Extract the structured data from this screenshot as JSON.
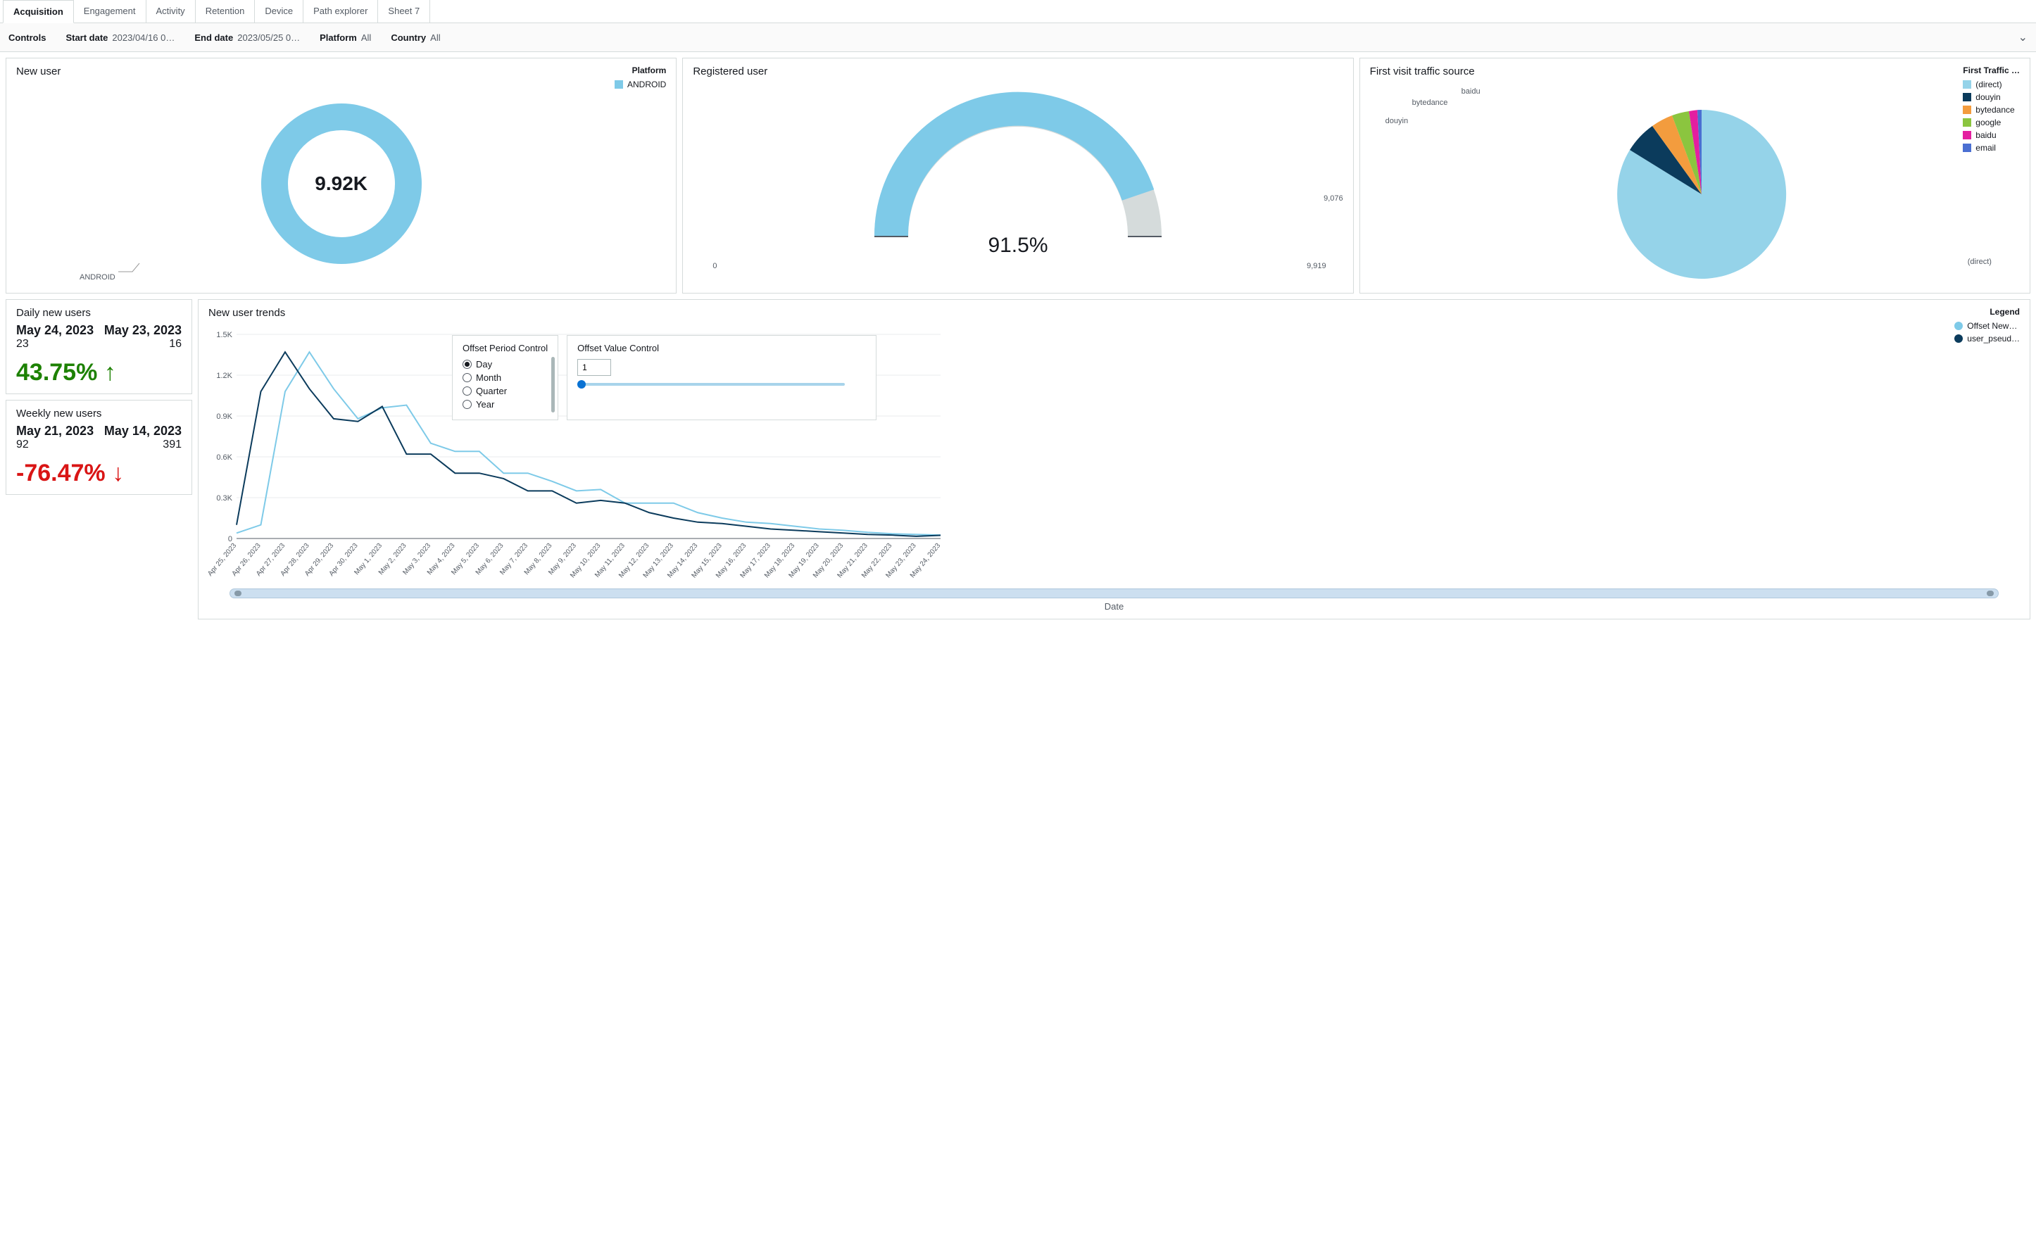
{
  "tabs": [
    "Acquisition",
    "Engagement",
    "Activity",
    "Retention",
    "Device",
    "Path explorer",
    "Sheet 7"
  ],
  "active_tab": "Acquisition",
  "controls": {
    "label": "Controls",
    "start_date_lbl": "Start date",
    "start_date_val": "2023/04/16 0…",
    "end_date_lbl": "End date",
    "end_date_val": "2023/05/25 0…",
    "platform_lbl": "Platform",
    "platform_val": "All",
    "country_lbl": "Country",
    "country_val": "All"
  },
  "new_user": {
    "title": "New user",
    "legend_title": "Platform",
    "legend_item": "ANDROID",
    "center_value": "9.92K",
    "footer_label": "ANDROID"
  },
  "registered_user": {
    "title": "Registered user",
    "percent_label": "91.5%",
    "min_label": "0",
    "val_label": "9,076",
    "max_label": "9,919"
  },
  "traffic_source": {
    "title": "First visit traffic source",
    "legend_title": "First Traffic …",
    "items": [
      {
        "name": "(direct)",
        "color": "#95d3e9"
      },
      {
        "name": "douyin",
        "color": "#0b3b5c"
      },
      {
        "name": "bytedance",
        "color": "#f39c3e"
      },
      {
        "name": "google",
        "color": "#8bc53f"
      },
      {
        "name": "baidu",
        "color": "#e41fa0"
      },
      {
        "name": "email",
        "color": "#4b6fd2"
      }
    ],
    "callouts": [
      "douyin",
      "bytedance",
      "baidu",
      "(direct)"
    ]
  },
  "daily": {
    "title": "Daily new users",
    "d1": "May 24, 2023",
    "v1": "23",
    "d2": "May 23, 2023",
    "v2": "16",
    "pct": "43.75% ↑"
  },
  "weekly": {
    "title": "Weekly new users",
    "d1": "May 21, 2023",
    "v1": "92",
    "d2": "May 14, 2023",
    "v2": "391",
    "pct": "-76.47% ↓"
  },
  "trends": {
    "title": "New user trends",
    "legend_title": "Legend",
    "legend_items": [
      "Offset New…",
      "user_pseud…"
    ],
    "offset_period_title": "Offset Period Control",
    "period_options": [
      "Day",
      "Month",
      "Quarter",
      "Year"
    ],
    "period_selected": "Day",
    "offset_value_title": "Offset Value Control",
    "offset_value": "1",
    "y_ticks": [
      "0",
      "0.3K",
      "0.6K",
      "0.9K",
      "1.2K",
      "1.5K"
    ],
    "x_axis_title": "Date"
  },
  "chart_data": [
    {
      "type": "pie",
      "title": "New user — Platform",
      "series": [
        {
          "name": "ANDROID",
          "values": [
            9920
          ]
        }
      ],
      "categories": [
        "ANDROID"
      ],
      "center_label": "9.92K"
    },
    {
      "type": "gauge",
      "title": "Registered user",
      "value": 9076,
      "max": 9919,
      "min": 0,
      "percent": 91.5
    },
    {
      "type": "pie",
      "title": "First visit traffic source",
      "categories": [
        "(direct)",
        "douyin",
        "bytedance",
        "google",
        "baidu",
        "email"
      ],
      "values": [
        83,
        7,
        5,
        3,
        1.5,
        0.5
      ]
    },
    {
      "type": "line",
      "title": "New user trends",
      "xlabel": "Date",
      "ylabel": "",
      "ylim": [
        0,
        1500
      ],
      "categories": [
        "Apr 25, 2023",
        "Apr 26, 2023",
        "Apr 27, 2023",
        "Apr 28, 2023",
        "Apr 29, 2023",
        "Apr 30, 2023",
        "May 1, 2023",
        "May 2, 2023",
        "May 3, 2023",
        "May 4, 2023",
        "May 5, 2023",
        "May 6, 2023",
        "May 7, 2023",
        "May 8, 2023",
        "May 9, 2023",
        "May 10, 2023",
        "May 11, 2023",
        "May 12, 2023",
        "May 13, 2023",
        "May 14, 2023",
        "May 15, 2023",
        "May 16, 2023",
        "May 17, 2023",
        "May 18, 2023",
        "May 19, 2023",
        "May 20, 2023",
        "May 21, 2023",
        "May 22, 2023",
        "May 23, 2023",
        "May 24, 2023"
      ],
      "series": [
        {
          "name": "Offset New…",
          "color": "#7ecae8",
          "values": [
            40,
            100,
            1080,
            1370,
            1100,
            880,
            960,
            980,
            700,
            640,
            640,
            480,
            480,
            420,
            350,
            360,
            260,
            260,
            260,
            190,
            150,
            120,
            110,
            90,
            70,
            60,
            45,
            35,
            30,
            25
          ]
        },
        {
          "name": "user_pseud…",
          "color": "#0b3b5c",
          "values": [
            100,
            1080,
            1370,
            1100,
            880,
            860,
            970,
            620,
            620,
            480,
            480,
            440,
            350,
            350,
            260,
            280,
            260,
            190,
            150,
            120,
            110,
            90,
            70,
            60,
            50,
            40,
            30,
            25,
            16,
            23
          ]
        }
      ]
    }
  ]
}
